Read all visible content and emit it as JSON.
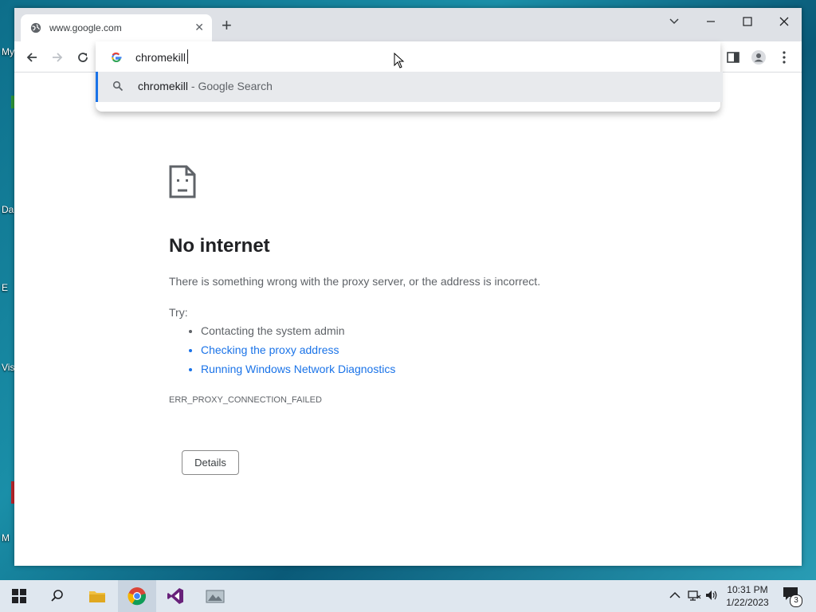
{
  "desktop": {
    "icon_labels": [
      "My",
      "Da",
      "E",
      "Vis",
      "M"
    ]
  },
  "browser": {
    "tab": {
      "title": "www.google.com"
    },
    "omnibox": {
      "value": "chromekill",
      "suggestion_query": "chromekill",
      "suggestion_suffix": " - Google Search"
    }
  },
  "error_page": {
    "title": "No internet",
    "description": "There is something wrong with the proxy server, or the address is incorrect.",
    "try_label": "Try:",
    "suggestions": [
      "Contacting the system admin",
      "Checking the proxy address",
      "Running Windows Network Diagnostics"
    ],
    "error_code": "ERR_PROXY_CONNECTION_FAILED",
    "details_button": "Details"
  },
  "taskbar": {
    "time": "10:31 PM",
    "date": "1/22/2023",
    "notification_count": "3"
  },
  "colors": {
    "accent": "#1a73e8",
    "titlebar": "#dee1e6",
    "taskbar": "#dfe7ef"
  }
}
